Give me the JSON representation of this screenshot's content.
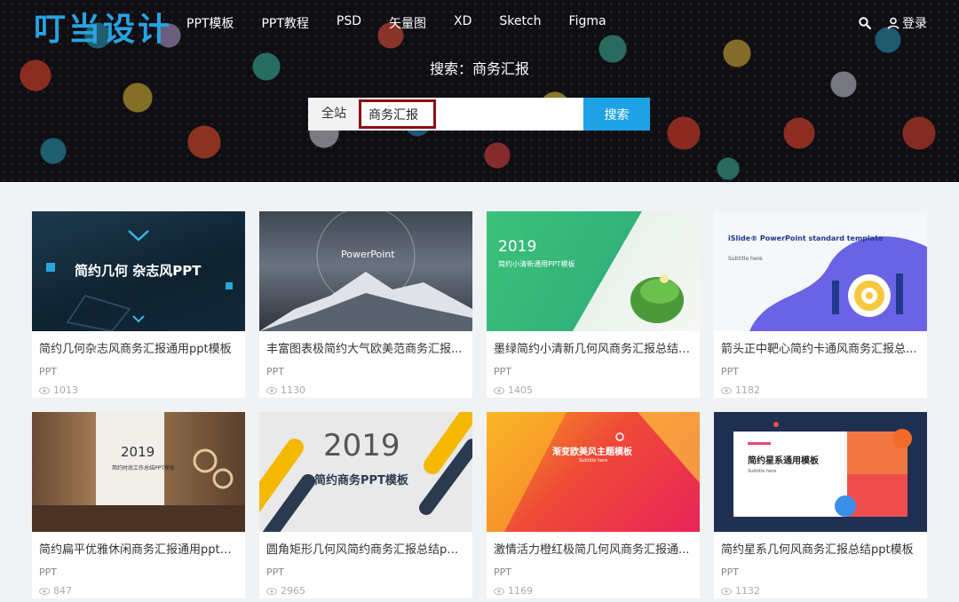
{
  "header": {
    "logo": "叮当设计",
    "nav": [
      "PPT模板",
      "PPT教程",
      "PSD",
      "矢量图",
      "XD",
      "Sketch",
      "Figma"
    ],
    "login": "登录",
    "search_title": "搜索：商务汇报",
    "search_scope": "全站",
    "search_value": "商务汇报",
    "search_button": "搜索"
  },
  "cards": [
    {
      "title": "简约几何杂志风商务汇报通用ppt模板",
      "tag": "PPT",
      "views": "1013",
      "thumb_text": "简约几何 杂志风PPT"
    },
    {
      "title": "丰富图表极简约大气欧美范商务汇报...",
      "tag": "PPT",
      "views": "1130",
      "thumb_text": "PowerPoint"
    },
    {
      "title": "墨绿简约小清新几何风商务汇报总结p...",
      "tag": "PPT",
      "views": "1405",
      "thumb_text": "2019",
      "thumb_sub": "简约小清新通用PPT模板"
    },
    {
      "title": "箭头正中靶心简约卡通风商务汇报总...",
      "tag": "PPT",
      "views": "1182",
      "thumb_text": "iSlide® PowerPoint standard template",
      "thumb_sub": "Subtitle here"
    },
    {
      "title": "简约扁平优雅休闲商务汇报通用ppt模板",
      "tag": "PPT",
      "views": "847",
      "thumb_text": "2019",
      "thumb_sub": "简约时尚工作总结PPT模板"
    },
    {
      "title": "圆角矩形几何风简约商务汇报总结ppt...",
      "tag": "PPT",
      "views": "2965",
      "thumb_text": "2019",
      "thumb_sub": "简约商务PPT模板"
    },
    {
      "title": "激情活力橙红极简几何风商务汇报通...",
      "tag": "PPT",
      "views": "1169",
      "thumb_text": "渐变欧美风主题模板",
      "thumb_sub": "Subtitle here"
    },
    {
      "title": "简约星系几何风商务汇报总结ppt模板",
      "tag": "PPT",
      "views": "1132",
      "thumb_text": "简约星系通用模板",
      "thumb_sub": "Subtitle here"
    }
  ],
  "colors": {
    "accent": "#1ea2e6",
    "logo": "#29a3e1",
    "highlight_border": "#8b0f14"
  }
}
